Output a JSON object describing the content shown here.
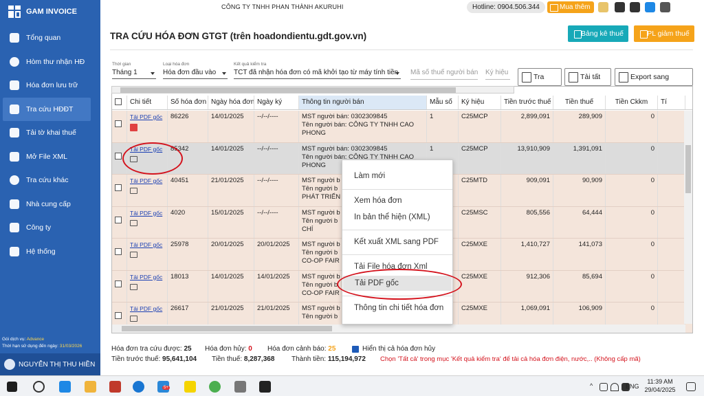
{
  "app": {
    "name": "GAM INVOICE"
  },
  "sidebar": {
    "items": [
      {
        "label": "Tổng quan"
      },
      {
        "label": "Hòm thư nhận HĐ"
      },
      {
        "label": "Hóa đơn lưu trữ"
      },
      {
        "label": "Tra cứu HĐĐT"
      },
      {
        "label": "Tải tờ khai thuế"
      },
      {
        "label": "Mở File XML"
      },
      {
        "label": "Tra cứu khác"
      },
      {
        "label": "Nhà cung cấp"
      },
      {
        "label": "Công ty"
      },
      {
        "label": "Hệ thống"
      }
    ],
    "plan_label": "Gói dịch vụ:",
    "plan_value": "Advance",
    "expiry_label": "Thời hạn sử dụng đến ngày:",
    "expiry_value": "31/03/2026",
    "user": "NGUYỄN THỊ THU HIỀN"
  },
  "topbar": {
    "company": "CÔNG TY TNHH PHAN THÀNH AKURUHI",
    "hotline": "Hotline: 0904.506.344",
    "buy_more": "Mua thêm"
  },
  "page": {
    "title": "TRA CỨU HÓA ĐƠN GTGT (trên hoadondientu.gdt.gov.vn)",
    "btn_bang_ke": "Bảng kê thuế",
    "btn_pl_giam": "PL giảm thuế"
  },
  "filters": {
    "time_label": "Thời gian",
    "time_value": "Tháng 1",
    "type_label": "Loại hóa đơn",
    "type_value": "Hóa đơn đầu vào",
    "result_label": "Kết quả kiểm tra",
    "result_value": "TCT đã nhận hóa đơn có mã khởi tạo từ máy tính tiền",
    "mst_placeholder": "Mã số thuế người bán",
    "kyhieu_placeholder": "Ký hiệu",
    "btn_search": "Tra cứu",
    "btn_download_all": "Tải tất cả",
    "btn_export": "Export sang PMKT"
  },
  "table": {
    "columns": [
      "Chi tiết",
      "Số hóa đơn",
      "Ngày hóa đơn",
      "Ngày ký",
      "Thông tin người bán",
      "Mẫu số",
      "Ký hiệu",
      "Tiền trước thuế",
      "Tiền thuế",
      "Tiền Ckkm",
      "Tí"
    ],
    "pdf_label": "Tải PDF gốc",
    "rows": [
      {
        "so": "86226",
        "ngay": "14/01/2025",
        "ky": "--/--/----",
        "mst": "MST người bán: 0302309845",
        "ten": "Tên người bán: CÔNG TY TNHH CAO",
        "ten2": "PHONG",
        "mau": "1",
        "kh": "C25MCP",
        "truoc": "2,899,091",
        "thue": "289,909",
        "ck": "0",
        "icon": "pdf"
      },
      {
        "so": "85342",
        "ngay": "14/01/2025",
        "ky": "--/--/----",
        "mst": "MST người bán: 0302309845",
        "ten": "Tên người bán: CÔNG TY TNHH CAO",
        "ten2": "PHONG",
        "mau": "1",
        "kh": "C25MCP",
        "truoc": "13,910,909",
        "thue": "1,391,091",
        "ck": "0",
        "icon": "print"
      },
      {
        "so": "40451",
        "ngay": "21/01/2025",
        "ky": "--/--/----",
        "mst": "MST người b",
        "ten": "Tên người b",
        "ten2": "PHÁT TRIỂN",
        "mau": "",
        "kh": "C25MTD",
        "truoc": "909,091",
        "thue": "90,909",
        "ck": "0",
        "icon": "print"
      },
      {
        "so": "4020",
        "ngay": "15/01/2025",
        "ky": "--/--/----",
        "mst": "MST người b",
        "ten": "Tên người b",
        "ten2": "CHÍ",
        "mau": "",
        "kh": "C25MSC",
        "truoc": "805,556",
        "thue": "64,444",
        "ck": "0",
        "icon": "print"
      },
      {
        "so": "25978",
        "ngay": "20/01/2025",
        "ky": "20/01/2025",
        "mst": "MST người b",
        "ten": "Tên người b",
        "ten2": "CO-OP FAIR",
        "mau": "",
        "kh": "C25MXE",
        "truoc": "1,410,727",
        "thue": "141,073",
        "ck": "0",
        "icon": "print"
      },
      {
        "so": "18013",
        "ngay": "14/01/2025",
        "ky": "14/01/2025",
        "mst": "MST người b",
        "ten": "Tên người b",
        "ten2": "CO-OP FAIR",
        "mau": "",
        "kh": "C25MXE",
        "truoc": "912,306",
        "thue": "85,694",
        "ck": "0",
        "icon": "print"
      },
      {
        "so": "26617",
        "ngay": "21/01/2025",
        "ky": "21/01/2025",
        "mst": "MST người b",
        "ten": "Tên người b",
        "ten2": "",
        "mau": "",
        "kh": "C25MXE",
        "truoc": "1,069,091",
        "thue": "106,909",
        "ck": "0",
        "icon": "print"
      }
    ]
  },
  "context_menu": {
    "items": [
      "Làm mới",
      "Xem hóa đơn",
      "In bản thể hiện (XML)",
      "Kết xuất XML sang PDF",
      "Tải File hóa đơn Xml",
      "Tải PDF gốc",
      "Thông tin chi tiết hóa đơn"
    ],
    "highlighted": "Tải PDF gốc"
  },
  "summary": {
    "count_label": "Hóa đơn tra cứu được:",
    "count_value": "25",
    "cancel_label": "Hóa đơn hủy:",
    "cancel_value": "0",
    "warn_label": "Hóa đơn cảnh báo:",
    "warn_value": "25",
    "show_cancel_label": "Hiển thị cả hóa đơn hủy",
    "pretax_label": "Tiền trước thuế:",
    "pretax_value": "95,641,104",
    "tax_label": "Tiền thuế:",
    "tax_value": "8,287,368",
    "total_label": "Thành tiền:",
    "total_value": "115,194,972",
    "note": "Chọn 'Tất cả' trong mục 'Kết quả kiểm tra' để tải cả hóa đơn điện, nước,.. (Không cấp mã)"
  },
  "taskbar": {
    "lang": "ENG",
    "time": "11:39 AM",
    "date": "29/04/2025",
    "badge": "5+"
  },
  "colors": {
    "sidebar": "#2a62b1",
    "accent_teal": "#17a9b8",
    "accent_orange": "#f5a31a",
    "row_bg": "#f4e5db",
    "highlight_red": "#d4121c"
  }
}
